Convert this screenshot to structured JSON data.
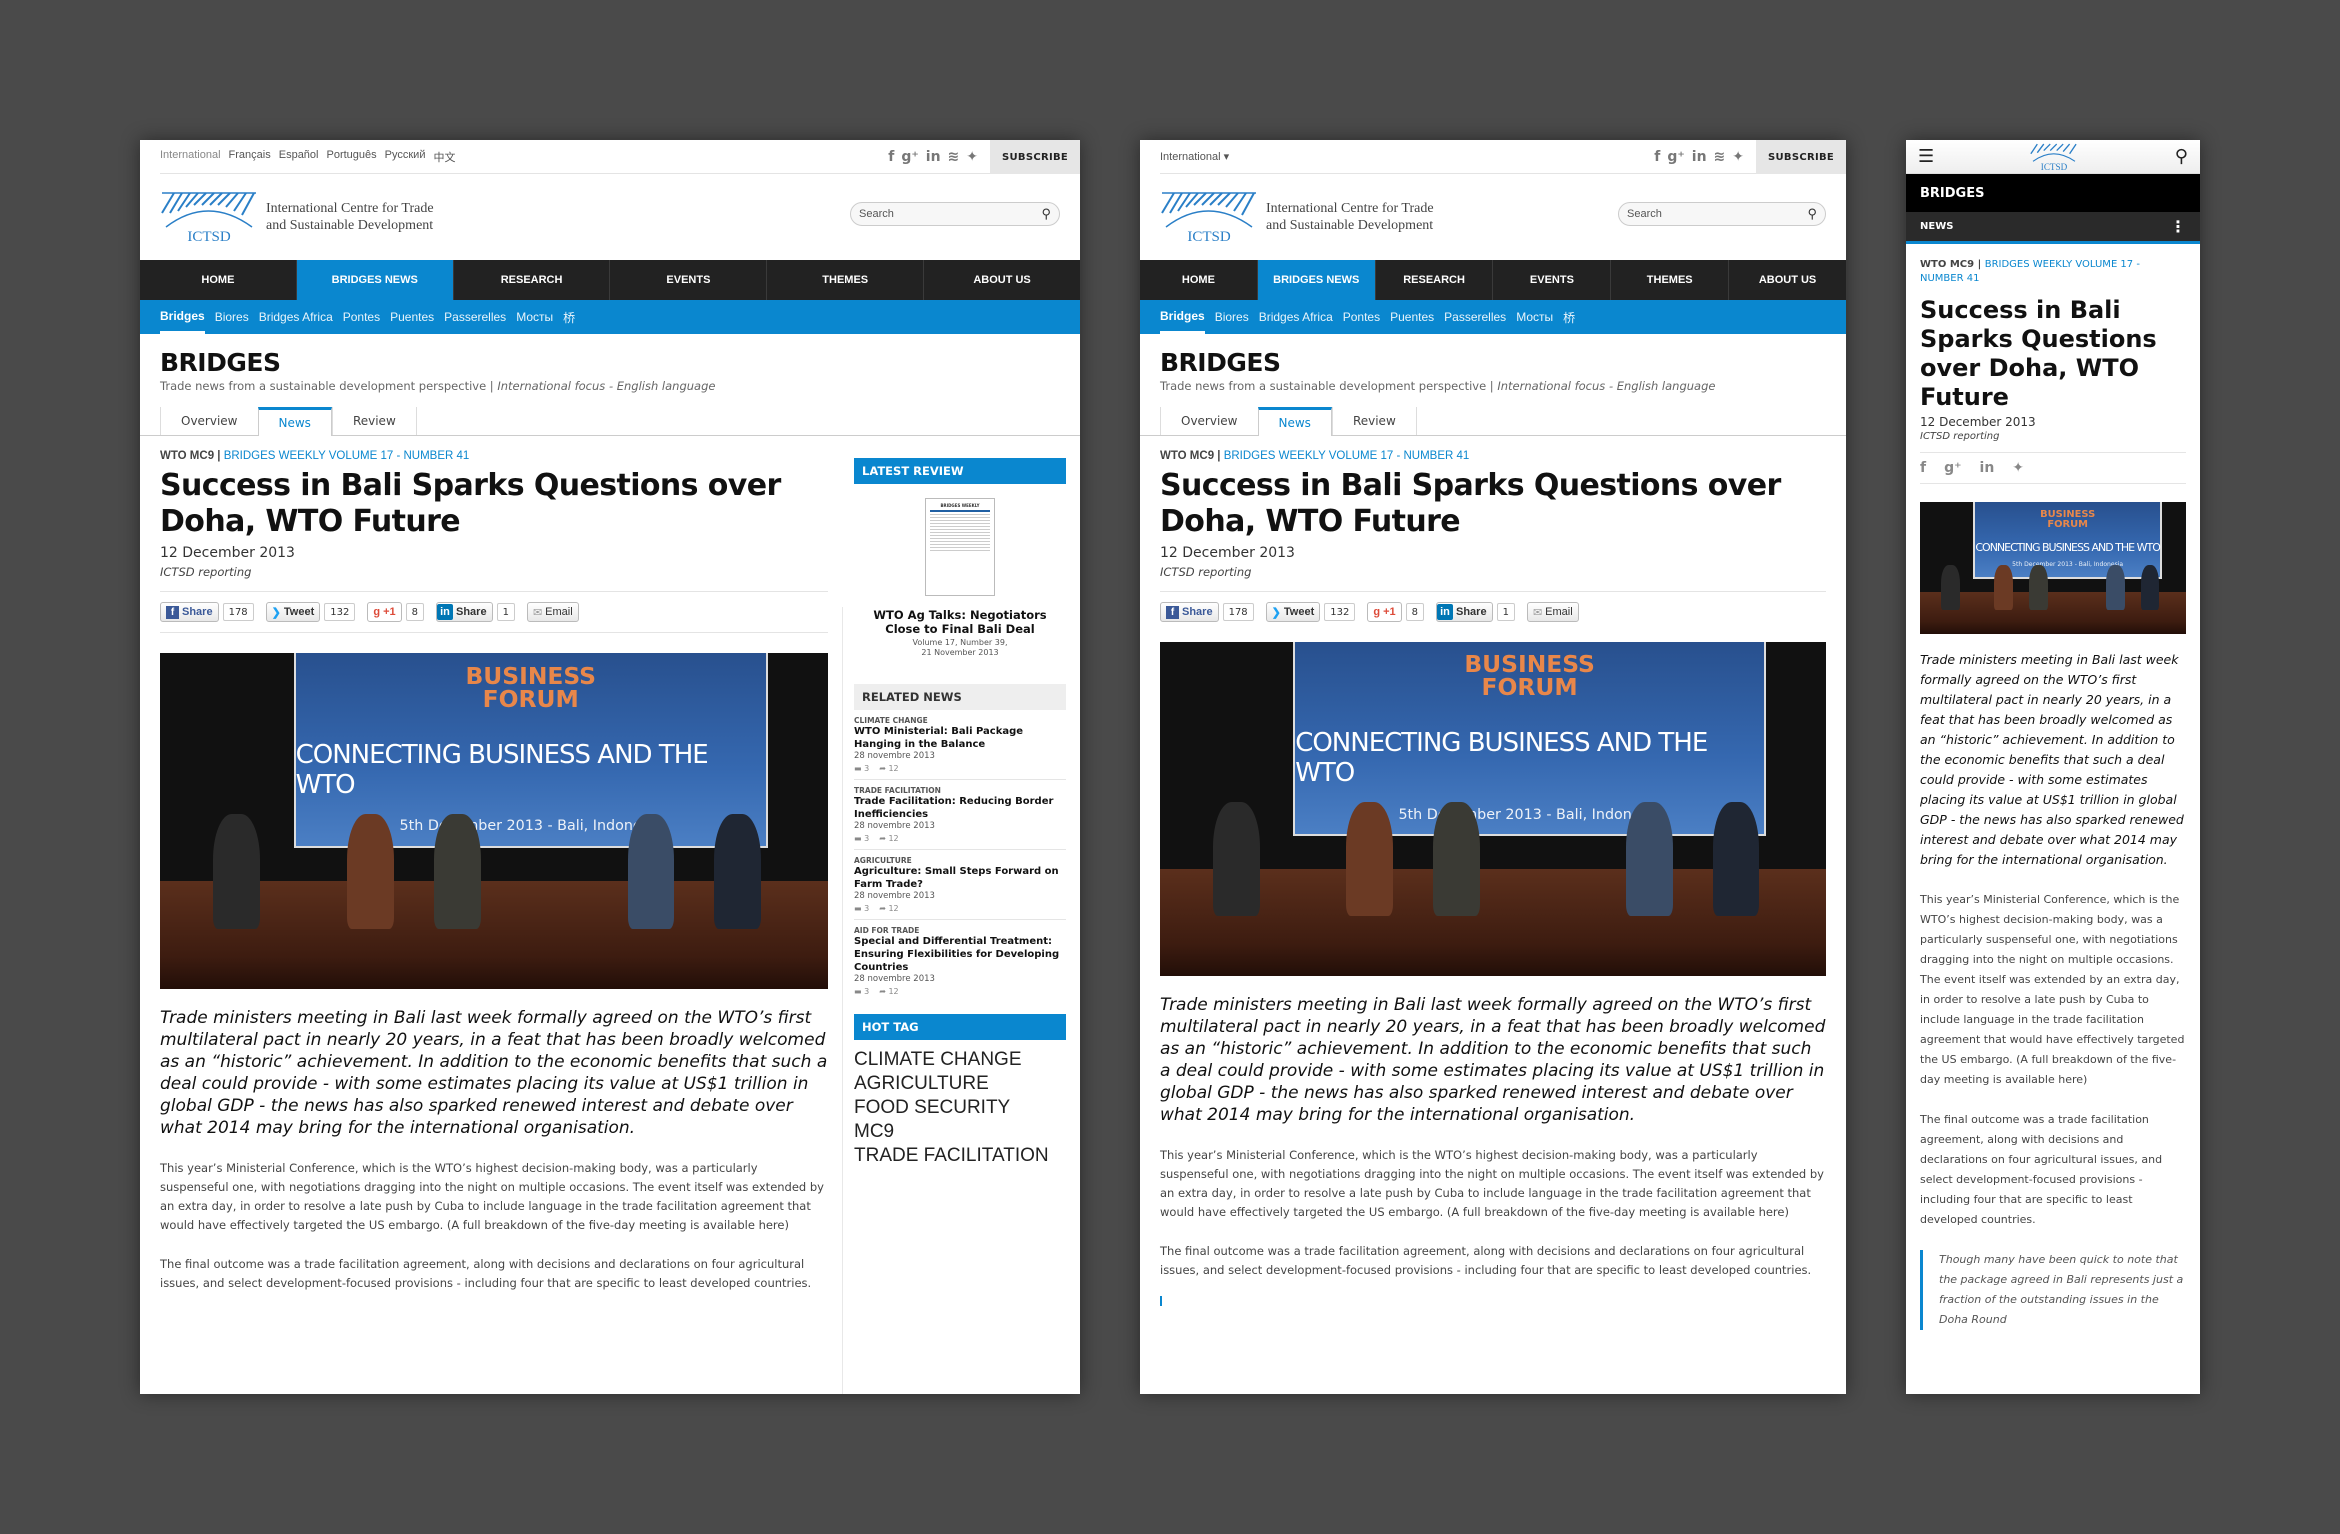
{
  "colors": {
    "accent": "#0a87cf",
    "nav_dark": "#222222",
    "page_bg": "#4a4a4a"
  },
  "top_bar": {
    "languages": [
      "International",
      "Français",
      "Español",
      "Português",
      "Русский",
      "中文"
    ],
    "language_dropdown": "International ▾",
    "social_icons": [
      "facebook-icon",
      "google-plus-icon",
      "linkedin-icon",
      "rss-icon",
      "twitter-icon"
    ],
    "social_glyphs": {
      "facebook": "f",
      "googleplus": "g⁺",
      "linkedin": "in",
      "rss": "≋",
      "twitter": "🐦"
    },
    "subscribe": "SUBSCRIBE"
  },
  "logo": {
    "mark": "ICTSD",
    "line1": "International Centre for Trade",
    "line2": "and Sustainable Development"
  },
  "search": {
    "placeholder": "Search",
    "icon": "⚲"
  },
  "main_nav": [
    {
      "label": "HOME",
      "active": false
    },
    {
      "label": "BRIDGES NEWS",
      "active": true
    },
    {
      "label": "RESEARCH",
      "active": false
    },
    {
      "label": "EVENTS",
      "active": false
    },
    {
      "label": "THEMES",
      "active": false
    },
    {
      "label": "ABOUT US",
      "active": false
    }
  ],
  "sub_nav": [
    "Bridges",
    "Biores",
    "Bridges Africa",
    "Pontes",
    "Puentes",
    "Passerelles",
    "Мосты",
    "桥"
  ],
  "section": {
    "title": "BRIDGES",
    "subtitle": "Trade news from a sustainable development perspective |",
    "subtitle_italic": "International focus - English language",
    "tabs": [
      "Overview",
      "News",
      "Review"
    ],
    "active_tab": "News"
  },
  "article": {
    "kicker": "WTO MC9",
    "kicker_sep": " | ",
    "kicker_link": "BRIDGES WEEKLY VOLUME 17 - NUMBER 41",
    "title": "Success in Bali Sparks Questions over Doha, WTO Future",
    "date": "12 December 2013",
    "byline": "ICTSD reporting",
    "share_buttons": [
      {
        "label": "Share",
        "count": "178",
        "network": "facebook"
      },
      {
        "label": "Tweet",
        "count": "132",
        "network": "twitter"
      },
      {
        "label": "+1",
        "count": "8",
        "network": "google-plus"
      },
      {
        "label": "Share",
        "count": "1",
        "network": "linkedin"
      },
      {
        "label": "Email",
        "count": null,
        "network": "email"
      }
    ],
    "photo": {
      "banner_brand": "BUSINESS",
      "banner_brand2": "FORUM",
      "banner_title": "CONNECTING BUSINESS AND THE WTO",
      "banner_subtitle": "5th December 2013 - Bali, Indonesia"
    },
    "lead": "Trade ministers meeting in Bali last week formally agreed on the WTO’s first multilateral pact in nearly 20 years, in a feat that has been broadly welcomed as an “historic” achievement. In addition to the economic benefits that such a deal could provide - with some estimates placing its value at US$1 trillion in global GDP - the news has also sparked renewed interest and debate over what 2014 may bring for the international organisation.",
    "paragraphs": [
      "This year’s Ministerial Conference, which is the WTO’s highest decision-making body, was a particularly suspenseful one, with negotiations dragging into the night on multiple occasions. The event itself was extended by an extra day, in order to resolve a late push by Cuba to include language in the trade facilitation agreement that would have effectively targeted the US embargo. (A full breakdown of the five-day meeting is available here)",
      "The final outcome was a trade facilitation agreement, along with decisions and declarations on four agricultural issues, and select development-focused provisions - including four that are specific to least developed countries."
    ],
    "quote": "Though many have been quick to note that the package agreed in Bali represents just a fraction of the outstanding issues in the Doha Round"
  },
  "sidebar": {
    "latest_review": {
      "heading": "LATEST REVIEW",
      "cover_title": "BRIDGES WEEKLY",
      "cover_headline": "WTO Ag Talks: Negotiators Close to Final Bali Deal",
      "title": "WTO Ag Talks: Negotiators Close to Final Bali Deal",
      "meta1": "Volume 17, Number 39,",
      "meta2": "21 November 2013"
    },
    "related_heading": "RELATED NEWS",
    "related": [
      {
        "category": "CLIMATE CHANGE",
        "title": "WTO Ministerial: Bali Package Hanging in the Balance",
        "date": "28 novembre 2013",
        "comments": "3",
        "shares": "12"
      },
      {
        "category": "TRADE FACILITATION",
        "title": "Trade Facilitation: Reducing Border Inefficiencies",
        "date": "28 novembre 2013",
        "comments": "3",
        "shares": "12"
      },
      {
        "category": "AGRICULTURE",
        "title": "Agriculture: Small Steps Forward on Farm Trade?",
        "date": "28 novembre 2013",
        "comments": "3",
        "shares": "12"
      },
      {
        "category": "AID FOR TRADE",
        "title": "Special and Differential Treatment: Ensuring Flexibilities for Developing Countries",
        "date": "28 novembre 2013",
        "comments": "3",
        "shares": "12"
      }
    ],
    "hot_tag_heading": "HOT TAG",
    "hot_tags": [
      "CLIMATE CHANGE",
      "AGRICULTURE",
      "FOOD SECURITY",
      "MC9",
      "TRADE FACILITATION"
    ]
  },
  "mobile": {
    "menu_icon": "☰",
    "search_icon": "⚲",
    "section": "BRIDGES",
    "subsection": "NEWS",
    "more_icon": "⋮",
    "kicker_link_line1": "BRIDGES WEEKLY VOLUME 17 -",
    "kicker_link_line2": "NUMBER 41"
  }
}
